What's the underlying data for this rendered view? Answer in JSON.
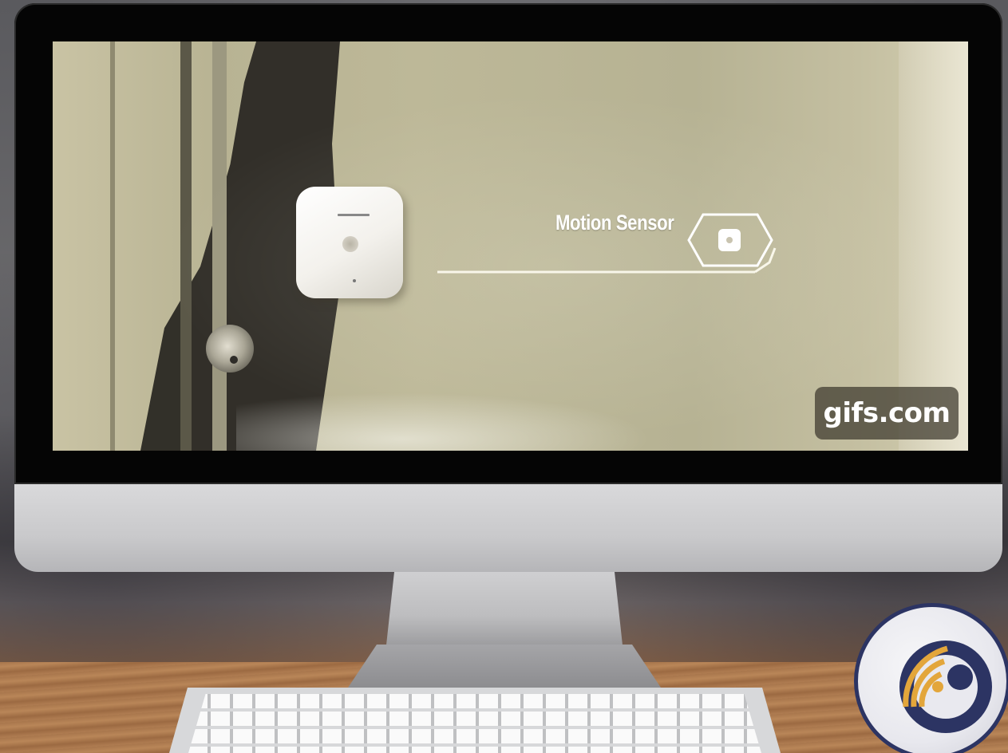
{
  "screen": {
    "callout": {
      "label": "Motion Sensor",
      "icon": "motion-sensor-hexagon-icon",
      "color": "#ffffff"
    },
    "watermark": "gifs.com"
  },
  "logo": {
    "icon": "wireless-signal-logo",
    "colors": {
      "ring": "#2c3463",
      "signal": "#e3a63b"
    }
  }
}
